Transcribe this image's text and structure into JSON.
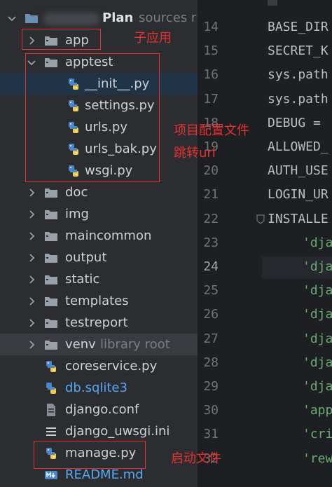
{
  "tree": {
    "root": {
      "name": "Plan",
      "hint": "sources r"
    },
    "items": [
      {
        "label": "app",
        "hint": "",
        "icon": "folder-icon"
      },
      {
        "label": "apptest",
        "hint": "",
        "icon": "folder-icon"
      },
      {
        "label": "__init__.py",
        "hint": "",
        "icon": "python-file-icon"
      },
      {
        "label": "settings.py",
        "hint": "",
        "icon": "python-file-icon"
      },
      {
        "label": "urls.py",
        "hint": "",
        "icon": "python-file-icon"
      },
      {
        "label": "urls_bak.py",
        "hint": "",
        "icon": "python-file-icon"
      },
      {
        "label": "wsgi.py",
        "hint": "",
        "icon": "python-file-icon"
      },
      {
        "label": "doc",
        "hint": "",
        "icon": "folder-icon"
      },
      {
        "label": "img",
        "hint": "",
        "icon": "folder-icon"
      },
      {
        "label": "maincommon",
        "hint": "",
        "icon": "folder-icon"
      },
      {
        "label": "output",
        "hint": "",
        "icon": "folder-icon"
      },
      {
        "label": "static",
        "hint": "",
        "icon": "folder-icon"
      },
      {
        "label": "templates",
        "hint": "",
        "icon": "folder-icon"
      },
      {
        "label": "testreport",
        "hint": "",
        "icon": "folder-icon"
      },
      {
        "label": "venv",
        "hint": "library root",
        "icon": "folder-icon"
      },
      {
        "label": "coreservice.py",
        "hint": "",
        "icon": "python-file-icon"
      },
      {
        "label": "db.sqlite3",
        "hint": "",
        "icon": "database-file-icon"
      },
      {
        "label": "django.conf",
        "hint": "",
        "icon": "config-file-icon"
      },
      {
        "label": "django_uwsgi.ini",
        "hint": "",
        "icon": "ini-file-icon"
      },
      {
        "label": "manage.py",
        "hint": "",
        "icon": "python-file-icon"
      },
      {
        "label": "README.md",
        "hint": "",
        "icon": "markdown-file-icon"
      }
    ]
  },
  "editor": {
    "line_numbers": [
      "14",
      "15",
      "16",
      "17",
      "18",
      "19",
      "20",
      "21",
      "22",
      "23",
      "24",
      "25",
      "26",
      "27",
      "28",
      "29",
      "30",
      "31",
      "32"
    ],
    "current_line": "24",
    "lines": [
      "BASE_DIR",
      "SECRET_K",
      "sys.path",
      "sys.path",
      "DEBUG = ",
      "ALLOWED_",
      "AUTH_USE",
      "LOGIN_UR",
      "INSTALLE",
      "'dja",
      "'dja",
      "'dja",
      "'dja",
      "'dja",
      "'dja",
      "'dja",
      "'app",
      "'cri",
      "'rew"
    ]
  },
  "annotations": {
    "app": "子应用",
    "project_config": "项目配置文件",
    "url_routing": "跳转url",
    "startup": "启动文件"
  },
  "colors": {
    "annotation": "#e8312e",
    "string_literal": "#6aab73",
    "selection": "#1f3446"
  }
}
